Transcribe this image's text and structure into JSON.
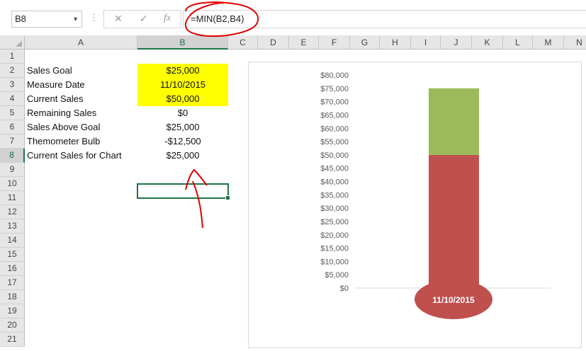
{
  "name_box": {
    "value": "B8"
  },
  "formula_bar": {
    "dots": "⋮",
    "cancel_icon": "✕",
    "enter_icon": "✓",
    "fx_label": "fx",
    "formula": "=MIN(B2,B4)"
  },
  "columns": [
    "A",
    "B",
    "C",
    "D",
    "E",
    "F",
    "G",
    "H",
    "I",
    "J",
    "K",
    "L",
    "M",
    "N"
  ],
  "rows": [
    "1",
    "2",
    "3",
    "4",
    "5",
    "6",
    "7",
    "8",
    "9",
    "10",
    "11",
    "12",
    "13",
    "14",
    "15",
    "16",
    "17",
    "18",
    "19",
    "20",
    "21"
  ],
  "cells": [
    {
      "row": 2,
      "label": "Sales Goal",
      "value": "$25,000",
      "highlight": true
    },
    {
      "row": 3,
      "label": "Measure Date",
      "value": "11/10/2015",
      "highlight": true
    },
    {
      "row": 4,
      "label": "Current Sales",
      "value": "$50,000",
      "highlight": true
    },
    {
      "row": 5,
      "label": "Remaining Sales",
      "value": "$0",
      "highlight": false
    },
    {
      "row": 6,
      "label": "Sales Above Goal",
      "value": "$25,000",
      "highlight": false
    },
    {
      "row": 7,
      "label": "Themometer Bulb",
      "value": "-$12,500",
      "highlight": false
    },
    {
      "row": 8,
      "label": "Current Sales for Chart",
      "value": "$25,000",
      "highlight": false
    }
  ],
  "colors": {
    "highlight": "#ffff00",
    "selection": "#217346",
    "annotation": "#e00000",
    "bar_red": "#c0504d",
    "bar_green": "#9bbb59"
  },
  "chart_data": {
    "type": "bar",
    "stacked": true,
    "categories": [
      "11/10/2015"
    ],
    "series": [
      {
        "values": [
          50000
        ],
        "color": "#c0504d"
      },
      {
        "values": [
          25000
        ],
        "color": "#9bbb59"
      }
    ],
    "yticks": [
      "$0",
      "$5,000",
      "$10,000",
      "$15,000",
      "$20,000",
      "$25,000",
      "$30,000",
      "$35,000",
      "$40,000",
      "$45,000",
      "$50,000",
      "$55,000",
      "$60,000",
      "$65,000",
      "$70,000",
      "$75,000",
      "$80,000"
    ],
    "ylim": [
      0,
      80000
    ],
    "bulb_label": "11/10/2015",
    "grid": false
  }
}
